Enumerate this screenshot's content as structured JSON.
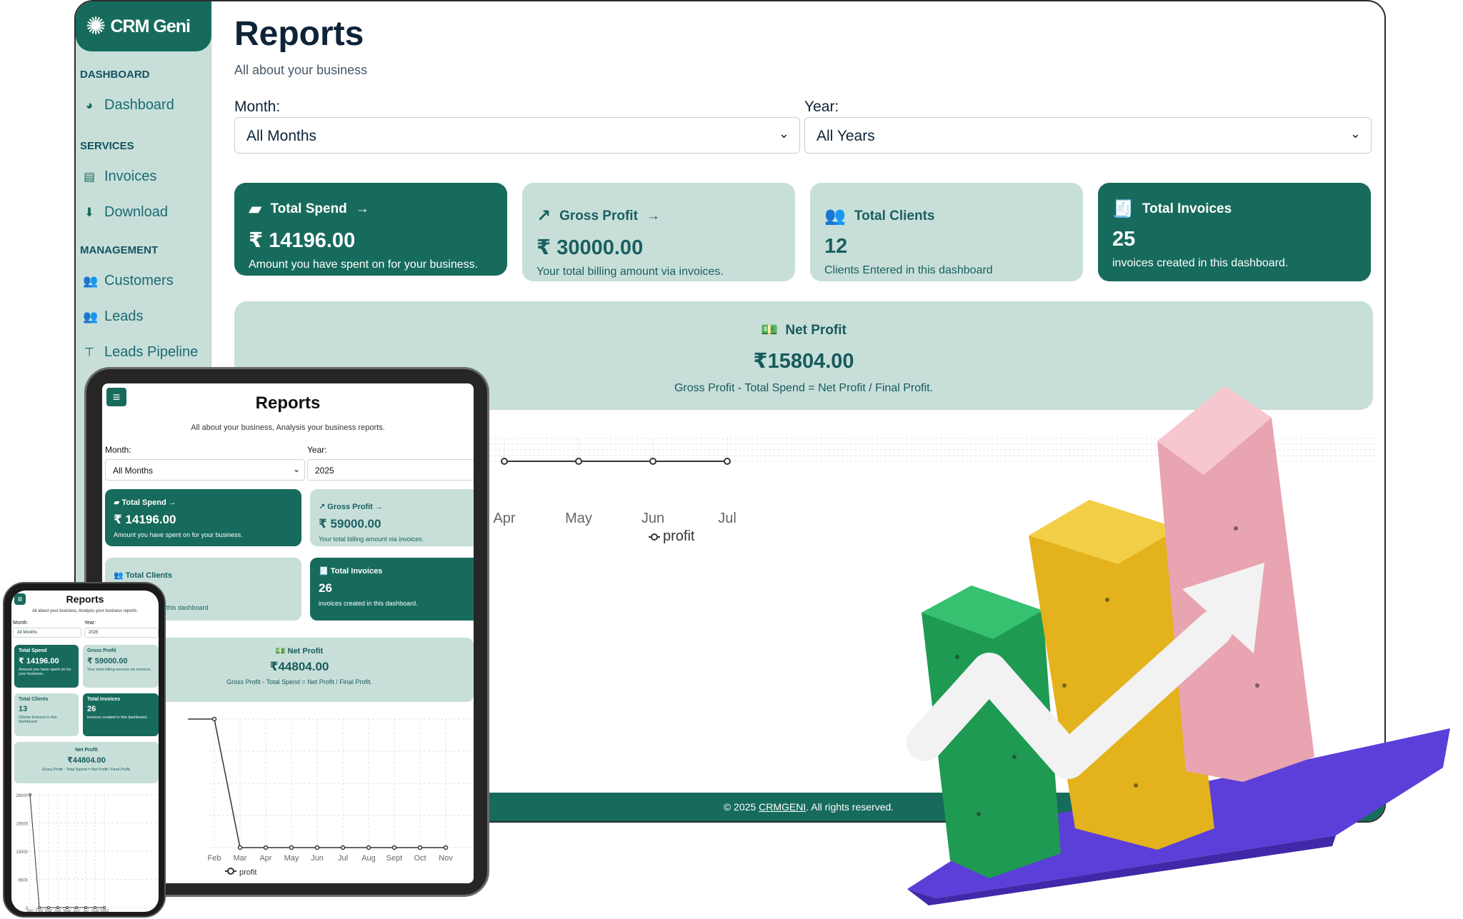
{
  "brand": {
    "name": "CRM Geni"
  },
  "sidebar": {
    "sections": [
      {
        "heading": "DASHBOARD",
        "items": [
          {
            "label": "Dashboard",
            "icon": "gauge-icon"
          }
        ]
      },
      {
        "heading": "SERVICES",
        "items": [
          {
            "label": "Invoices",
            "icon": "file-icon"
          },
          {
            "label": "Download",
            "icon": "download-icon"
          }
        ]
      },
      {
        "heading": "MANAGEMENT",
        "items": [
          {
            "label": "Customers",
            "icon": "users-icon"
          },
          {
            "label": "Leads",
            "icon": "users-icon"
          },
          {
            "label": "Leads Pipeline",
            "icon": "funnel-icon"
          }
        ]
      }
    ]
  },
  "page": {
    "title": "Reports",
    "subtitle": "All about your business"
  },
  "filters": {
    "month_label": "Month:",
    "month_value": "All Months",
    "year_label": "Year:",
    "year_value": "All Years"
  },
  "cards": [
    {
      "title": "Total Spend",
      "value": "₹ 14196.00",
      "desc": "Amount you have spent on for your business.",
      "icon": "wallet-icon"
    },
    {
      "title": "Gross Profit",
      "value": "₹ 30000.00",
      "desc": "Your total billing amount via invoices.",
      "icon": "trend-up-icon"
    },
    {
      "title": "Total Clients",
      "value": "12",
      "desc": "Clients Entered in this dashboard",
      "icon": "users-icon"
    },
    {
      "title": "Total Invoices",
      "value": "25",
      "desc": "invoices created in this dashboard.",
      "icon": "invoice-icon"
    }
  ],
  "net_profit": {
    "title": "Net Profit",
    "value": "₹15804.00",
    "desc": "Gross Profit - Total Spend = Net Profit / Final Profit."
  },
  "chart_data": [
    {
      "type": "line",
      "categories": [
        "Apr",
        "May",
        "Jun",
        "Jul"
      ],
      "series": [
        {
          "name": "profit",
          "values": [
            0,
            0,
            0,
            0
          ]
        }
      ]
    },
    {
      "type": "line",
      "categories": [
        "Feb",
        "Mar",
        "Apr",
        "May",
        "Jun",
        "Jul",
        "Aug",
        "Sept",
        "Oct",
        "Nov"
      ],
      "series": [
        {
          "name": "profit",
          "values": [
            26000,
            0,
            0,
            0,
            0,
            0,
            0,
            0,
            0,
            0
          ]
        }
      ]
    },
    {
      "type": "line",
      "categories": [
        "Jan",
        "Feb",
        "Mar",
        "Apr",
        "May",
        "Jun",
        "Jul",
        "Aug",
        "Sept"
      ],
      "y_ticks": [
        "26000",
        "19500",
        "13000",
        "6500",
        "0"
      ],
      "series": [
        {
          "name": "profit",
          "values": [
            26000,
            0,
            0,
            0,
            0,
            0,
            0,
            0,
            0
          ]
        }
      ]
    }
  ],
  "footer": {
    "prefix": "© 2025 ",
    "link": "CRMGENI",
    "suffix": ". All rights reserved."
  },
  "tablet": {
    "title": "Reports",
    "subtitle": "All about your business, Analysis your business reports.",
    "month_label": "Month:",
    "month_value": "All Months",
    "year_label": "Year:",
    "year_value": "2025",
    "cards": [
      {
        "title": "Total Spend",
        "value": "₹ 14196.00",
        "desc": "Amount you have spent on for your business."
      },
      {
        "title": "Gross Profit",
        "value": "₹ 59000.00",
        "desc": "Your total billing amount via invoices."
      },
      {
        "title": "Total Clients",
        "value": "13",
        "desc": "Clients Entered in this dashboard"
      },
      {
        "title": "Total Invoices",
        "value": "26",
        "desc": "invoices created in this dashboard."
      }
    ],
    "net_title": "Net Profit",
    "net_value": "₹44804.00",
    "net_desc": "Gross Profit - Total Spend = Net Profit / Final Profit."
  },
  "phone": {
    "title": "Reports",
    "subtitle": "All about your business, Analysis your business reports.",
    "month_label": "Month:",
    "month_value": "All Months",
    "year_label": "Year:",
    "year_value": "2025",
    "cards": [
      {
        "title": "Total Spend",
        "value": "₹ 14196.00",
        "desc": "Amount you have spent on for your business."
      },
      {
        "title": "Gross Profit",
        "value": "₹ 59000.00",
        "desc": "Your total billing amount via invoices."
      },
      {
        "title": "Total Clients",
        "value": "13",
        "desc": "Clients Entered in this dashboard"
      },
      {
        "title": "Total Invoices",
        "value": "26",
        "desc": "invoices created in this dashboard."
      }
    ],
    "net_title": "Net Profit",
    "net_value": "₹44804.00",
    "net_desc": "Gross Profit - Total Spend = Net Profit / Final Profit."
  },
  "colors": {
    "primary": "#176b5c",
    "light": "#c8dfd9",
    "bar_green": "#1e9a52",
    "bar_yellow": "#e3b21d",
    "bar_pink": "#e8a4b0",
    "base_purple": "#5b3fd8"
  }
}
